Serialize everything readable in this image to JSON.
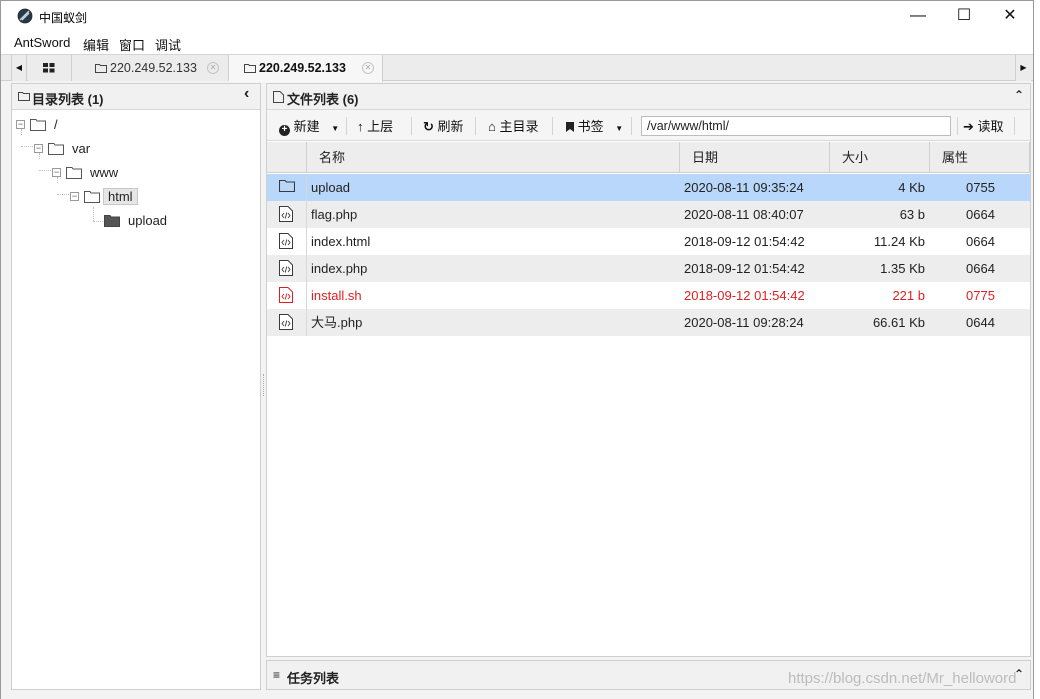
{
  "window": {
    "title": "中国蚁剑",
    "app_icon": "antsword-icon",
    "controls": {
      "minimize": "—",
      "maximize": "☐",
      "close": "✕"
    }
  },
  "menu": [
    {
      "label": "AntSword"
    },
    {
      "label": "编辑"
    },
    {
      "label": "窗口"
    },
    {
      "label": "调试"
    }
  ],
  "tabs": {
    "grid_icon": "grid-icon",
    "items": [
      {
        "label": "220.249.52.133",
        "active": false
      },
      {
        "label": "220.249.52.133",
        "active": true
      }
    ],
    "nav_left": "◀",
    "nav_right": "▶"
  },
  "dir_panel": {
    "title": "目录列表 (1)",
    "collapse": "‹",
    "tree": [
      {
        "label": "/",
        "level": 0,
        "toggle": "−",
        "folder": "open"
      },
      {
        "label": "var",
        "level": 1,
        "toggle": "−",
        "folder": "open"
      },
      {
        "label": "www",
        "level": 2,
        "toggle": "−",
        "folder": "open"
      },
      {
        "label": "html",
        "level": 3,
        "toggle": "−",
        "folder": "open",
        "selected": true
      },
      {
        "label": "upload",
        "level": 4,
        "toggle": "",
        "folder": "closed"
      }
    ]
  },
  "file_panel": {
    "title": "文件列表 (6)",
    "collapse": "⌃",
    "toolbar": {
      "new_label": "新建",
      "up_label": "上层",
      "refresh_label": "刷新",
      "home_label": "主目录",
      "bookmark_label": "书签",
      "path_value": "/var/www/html/",
      "read_label": "读取"
    },
    "columns": {
      "name": "名称",
      "date": "日期",
      "size": "大小",
      "attr": "属性"
    },
    "rows": [
      {
        "type": "folder",
        "name": "upload",
        "date": "2020-08-11 09:35:24",
        "size": "4 Kb",
        "attr": "0755",
        "selected": true,
        "danger": false
      },
      {
        "type": "file",
        "name": "flag.php",
        "date": "2020-08-11 08:40:07",
        "size": "63 b",
        "attr": "0664",
        "selected": false,
        "danger": false
      },
      {
        "type": "file",
        "name": "index.html",
        "date": "2018-09-12 01:54:42",
        "size": "11.24 Kb",
        "attr": "0664",
        "selected": false,
        "danger": false
      },
      {
        "type": "file",
        "name": "index.php",
        "date": "2018-09-12 01:54:42",
        "size": "1.35 Kb",
        "attr": "0664",
        "selected": false,
        "danger": false
      },
      {
        "type": "file",
        "name": "install.sh",
        "date": "2018-09-12 01:54:42",
        "size": "221 b",
        "attr": "0775",
        "selected": false,
        "danger": true
      },
      {
        "type": "file",
        "name": "大马.php",
        "date": "2020-08-11 09:28:24",
        "size": "66.61 Kb",
        "attr": "0644",
        "selected": false,
        "danger": false
      }
    ]
  },
  "task_panel": {
    "title": "任务列表",
    "collapse": "⌃"
  },
  "watermark": "https://blog.csdn.net/Mr_helloword",
  "colors": {
    "selected_row": "#b9d7fa",
    "danger_text": "#e02020",
    "panel_header": "#f1f1f1"
  }
}
